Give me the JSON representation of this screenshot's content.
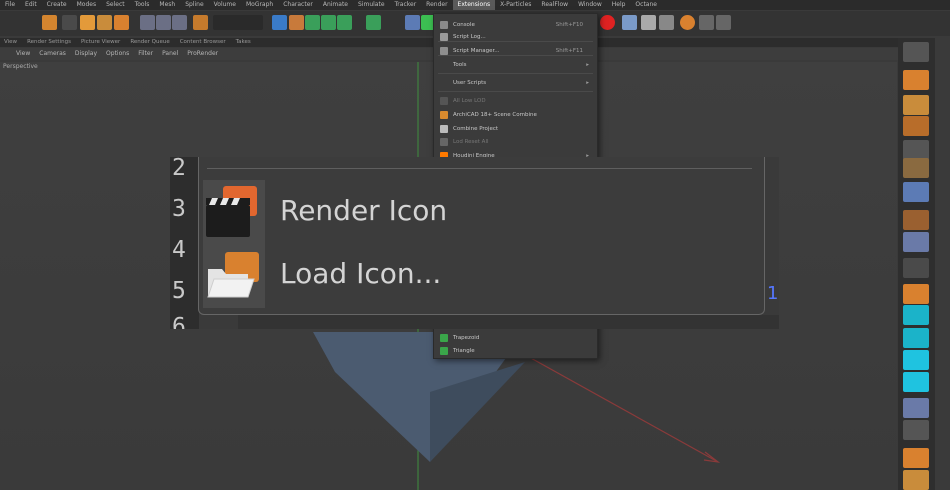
{
  "menubar": {
    "items": [
      "File",
      "Edit",
      "Create",
      "Modes",
      "Select",
      "Tools",
      "Mesh",
      "Spline",
      "Volume",
      "MoGraph",
      "Character",
      "Animate",
      "Simulate",
      "Tracker",
      "Render",
      "Extensions",
      "X-Particles",
      "RealFlow",
      "Window",
      "Help",
      "Octane"
    ],
    "active": "Extensions"
  },
  "tabbar": {
    "items": [
      "View",
      "Render Settings",
      "Picture Viewer",
      "Render Queue",
      "Content Browser",
      "Takes"
    ]
  },
  "viewmenu": {
    "items": [
      "View",
      "Cameras",
      "Display",
      "Options",
      "Filter",
      "Panel",
      "ProRender"
    ]
  },
  "viewport": {
    "label": "Perspective"
  },
  "dropdown": {
    "items": [
      {
        "label": "Console",
        "shortcut": "Shift+F10",
        "icon_color": "#8a8a8a"
      },
      {
        "label": "Script Log...",
        "shortcut": "",
        "icon_color": "#9a9a9a"
      },
      {
        "label": "Script Manager...",
        "shortcut": "Shift+F11",
        "icon_color": "#8e8e8e"
      },
      {
        "label": "Tools",
        "shortcut": "",
        "icon_color": "",
        "submenu": true
      },
      {
        "label": "User Scripts",
        "shortcut": "",
        "icon_color": "",
        "submenu": true
      },
      {
        "label": "All Low LOD",
        "shortcut": "",
        "icon_color": "#555555",
        "dim": true
      },
      {
        "label": "ArchiCAD 18+ Scene Combine",
        "shortcut": "",
        "icon_color": "#d88a2e"
      },
      {
        "label": "Combine Project",
        "shortcut": "",
        "icon_color": "#bbbbbb"
      },
      {
        "label": "Lod Reset All",
        "shortcut": "",
        "icon_color": "#666666",
        "dim": true
      },
      {
        "label": "Houdini Engine",
        "shortcut": "",
        "icon_color": "#ff7a00",
        "submenu": true
      }
    ],
    "bottom_items": [
      {
        "label": "Trapezoid",
        "icon_color": "#3aa64a"
      },
      {
        "label": "Triangle",
        "icon_color": "#3aa64a"
      }
    ]
  },
  "zoom": {
    "line_numbers": [
      "2",
      "3",
      "4",
      "5",
      "6"
    ],
    "items": [
      {
        "label": "Render Icon"
      },
      {
        "label": "Load Icon..."
      }
    ],
    "stray_number": "1"
  },
  "colors": {
    "accent_orange": "#e2672f",
    "folder_orange": "#d9812f",
    "highlight_blue": "#5577ff",
    "dark_bg": "#3a3a3a"
  }
}
